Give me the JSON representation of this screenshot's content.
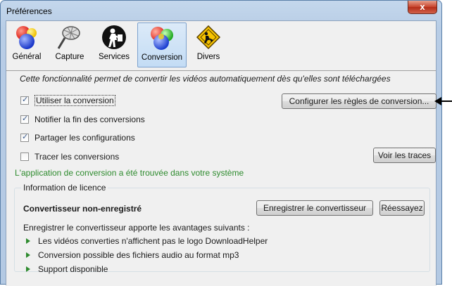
{
  "window": {
    "title": "Préférences",
    "close_glyph": "x"
  },
  "tabs": [
    {
      "label": "Général",
      "icon": "general-balls-icon",
      "selected": false
    },
    {
      "label": "Capture",
      "icon": "capture-net-icon",
      "selected": false
    },
    {
      "label": "Services",
      "icon": "services-person-icon",
      "selected": false
    },
    {
      "label": "Conversion",
      "icon": "conversion-balls-icon",
      "selected": true
    },
    {
      "label": "Divers",
      "icon": "divers-diamond-icon",
      "selected": false
    }
  ],
  "conversion": {
    "description": "Cette fonctionnalité permet de convertir les vidéos automatiquement dès qu'elles sont téléchargées",
    "options": [
      {
        "label": "Utiliser la conversion",
        "checked": true
      },
      {
        "label": "Notifier la fin des conversions",
        "checked": true
      },
      {
        "label": "Partager les configurations",
        "checked": true
      },
      {
        "label": "Tracer les conversions",
        "checked": false
      }
    ],
    "configure_button": "Configurer les règles de conversion...",
    "traces_button": "Voir les traces",
    "found_message": "L'application de conversion a été trouvée dans votre système"
  },
  "license": {
    "legend": "Information de licence",
    "status": "Convertisseur non-enregistré",
    "register_button": "Enregistrer le convertisseur",
    "retry_button": "Réessayez",
    "advantages_intro": "Enregistrer le convertisseur apporte les avantages suivants :",
    "advantages": [
      "Les vidéos converties n'affichent pas le logo DownloadHelper",
      "Conversion possible des fichiers audio au format mp3",
      "Support disponible"
    ]
  },
  "colors": {
    "accent_green": "#2e8b2e",
    "selected_tab": "#c3dcf5",
    "close_red": "#c8432c"
  }
}
